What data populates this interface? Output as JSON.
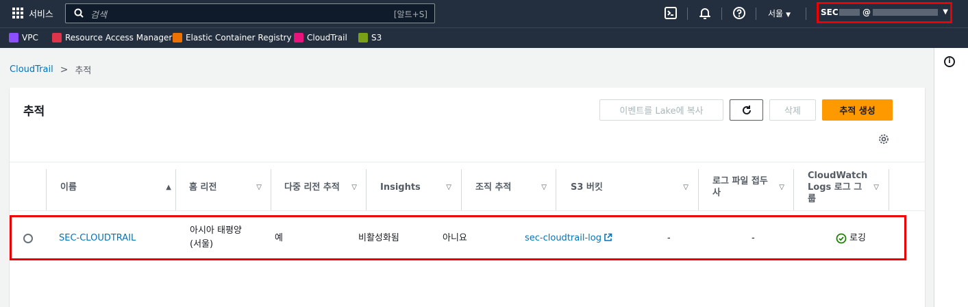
{
  "topnav": {
    "services_label": "서비스",
    "search_placeholder": "검색",
    "search_shortcut": "[알트+S]",
    "region_label": "서울",
    "account_prefix": "SEC",
    "account_at": "@"
  },
  "favorites": [
    {
      "label": "VPC",
      "color": "#8c4fff"
    },
    {
      "label": "Resource Access Manager",
      "color": "#dd344c"
    },
    {
      "label": "Elastic Container Registry",
      "color": "#ed7100"
    },
    {
      "label": "CloudTrail",
      "color": "#e7157b"
    },
    {
      "label": "S3",
      "color": "#7aa116"
    }
  ],
  "breadcrumb": {
    "root": "CloudTrail",
    "current": "추적"
  },
  "panel": {
    "title": "추적",
    "copy_to_lake_label": "이벤트를 Lake에 복사",
    "delete_label": "삭제",
    "create_label": "추적 생성"
  },
  "table": {
    "headers": {
      "name": "이름",
      "home_region": "홈 리전",
      "multi_region": "다중 리전 추적",
      "insights": "Insights",
      "org_trail": "조직 추적",
      "s3_bucket": "S3 버킷",
      "log_file_prefix": "로그 파일 접두사",
      "cw_logs_group": "CloudWatch Logs 로그 그룹"
    },
    "rows": [
      {
        "name": "SEC-CLOUDTRAIL",
        "home_region": "아시아 태평양(서울)",
        "multi_region": "예",
        "insights": "비활성화됨",
        "org_trail": "아니요",
        "s3_bucket": "sec-cloudtrail-log",
        "log_file_prefix": "-",
        "cw_logs_group": "-",
        "status": "로깅"
      }
    ]
  },
  "colors": {
    "nav_bg": "#232f3e",
    "link": "#0073bb",
    "primary": "#ff9900",
    "highlight": "#ee0000",
    "success": "#1d8102"
  }
}
